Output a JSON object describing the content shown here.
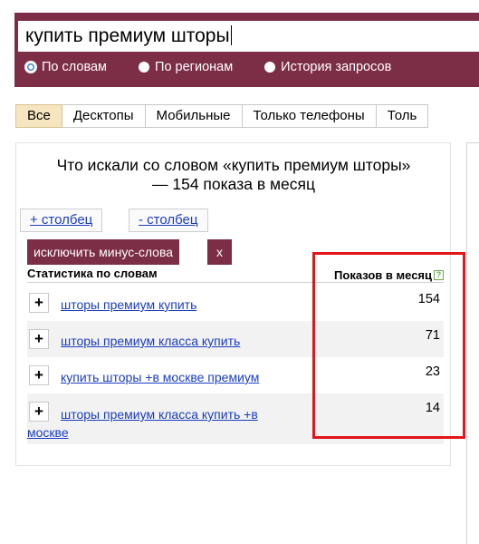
{
  "search": {
    "query": "купить премиум шторы",
    "options": [
      "По словам",
      "По регионам",
      "История запросов"
    ],
    "selected_option": "По словам"
  },
  "tabs": [
    "Все",
    "Десктопы",
    "Мобильные",
    "Только телефоны",
    "Толь"
  ],
  "active_tab": "Все",
  "panel": {
    "title": "Что искали со словом «купить премиум шторы» — 154 показа в месяц",
    "add_column": "+ столбец",
    "remove_column": "- столбец",
    "exclude_button": "исключить минус-слова",
    "close_button": "x",
    "header_left": "Статистика по словам",
    "header_right": "Показов в месяц",
    "help_icon": "?",
    "rows": [
      {
        "phrase": "шторы премиум купить",
        "count": "154"
      },
      {
        "phrase": "шторы премиум класса купить",
        "count": "71"
      },
      {
        "phrase": "купить шторы +в москве премиум",
        "count": "23"
      },
      {
        "phrase": "шторы премиум класса купить +в москве",
        "count": "14"
      }
    ]
  },
  "colors": {
    "brand": "#7d2e47",
    "link": "#1a3dc1",
    "active_tab": "#f6e6bf",
    "highlight": "#e2151a"
  }
}
